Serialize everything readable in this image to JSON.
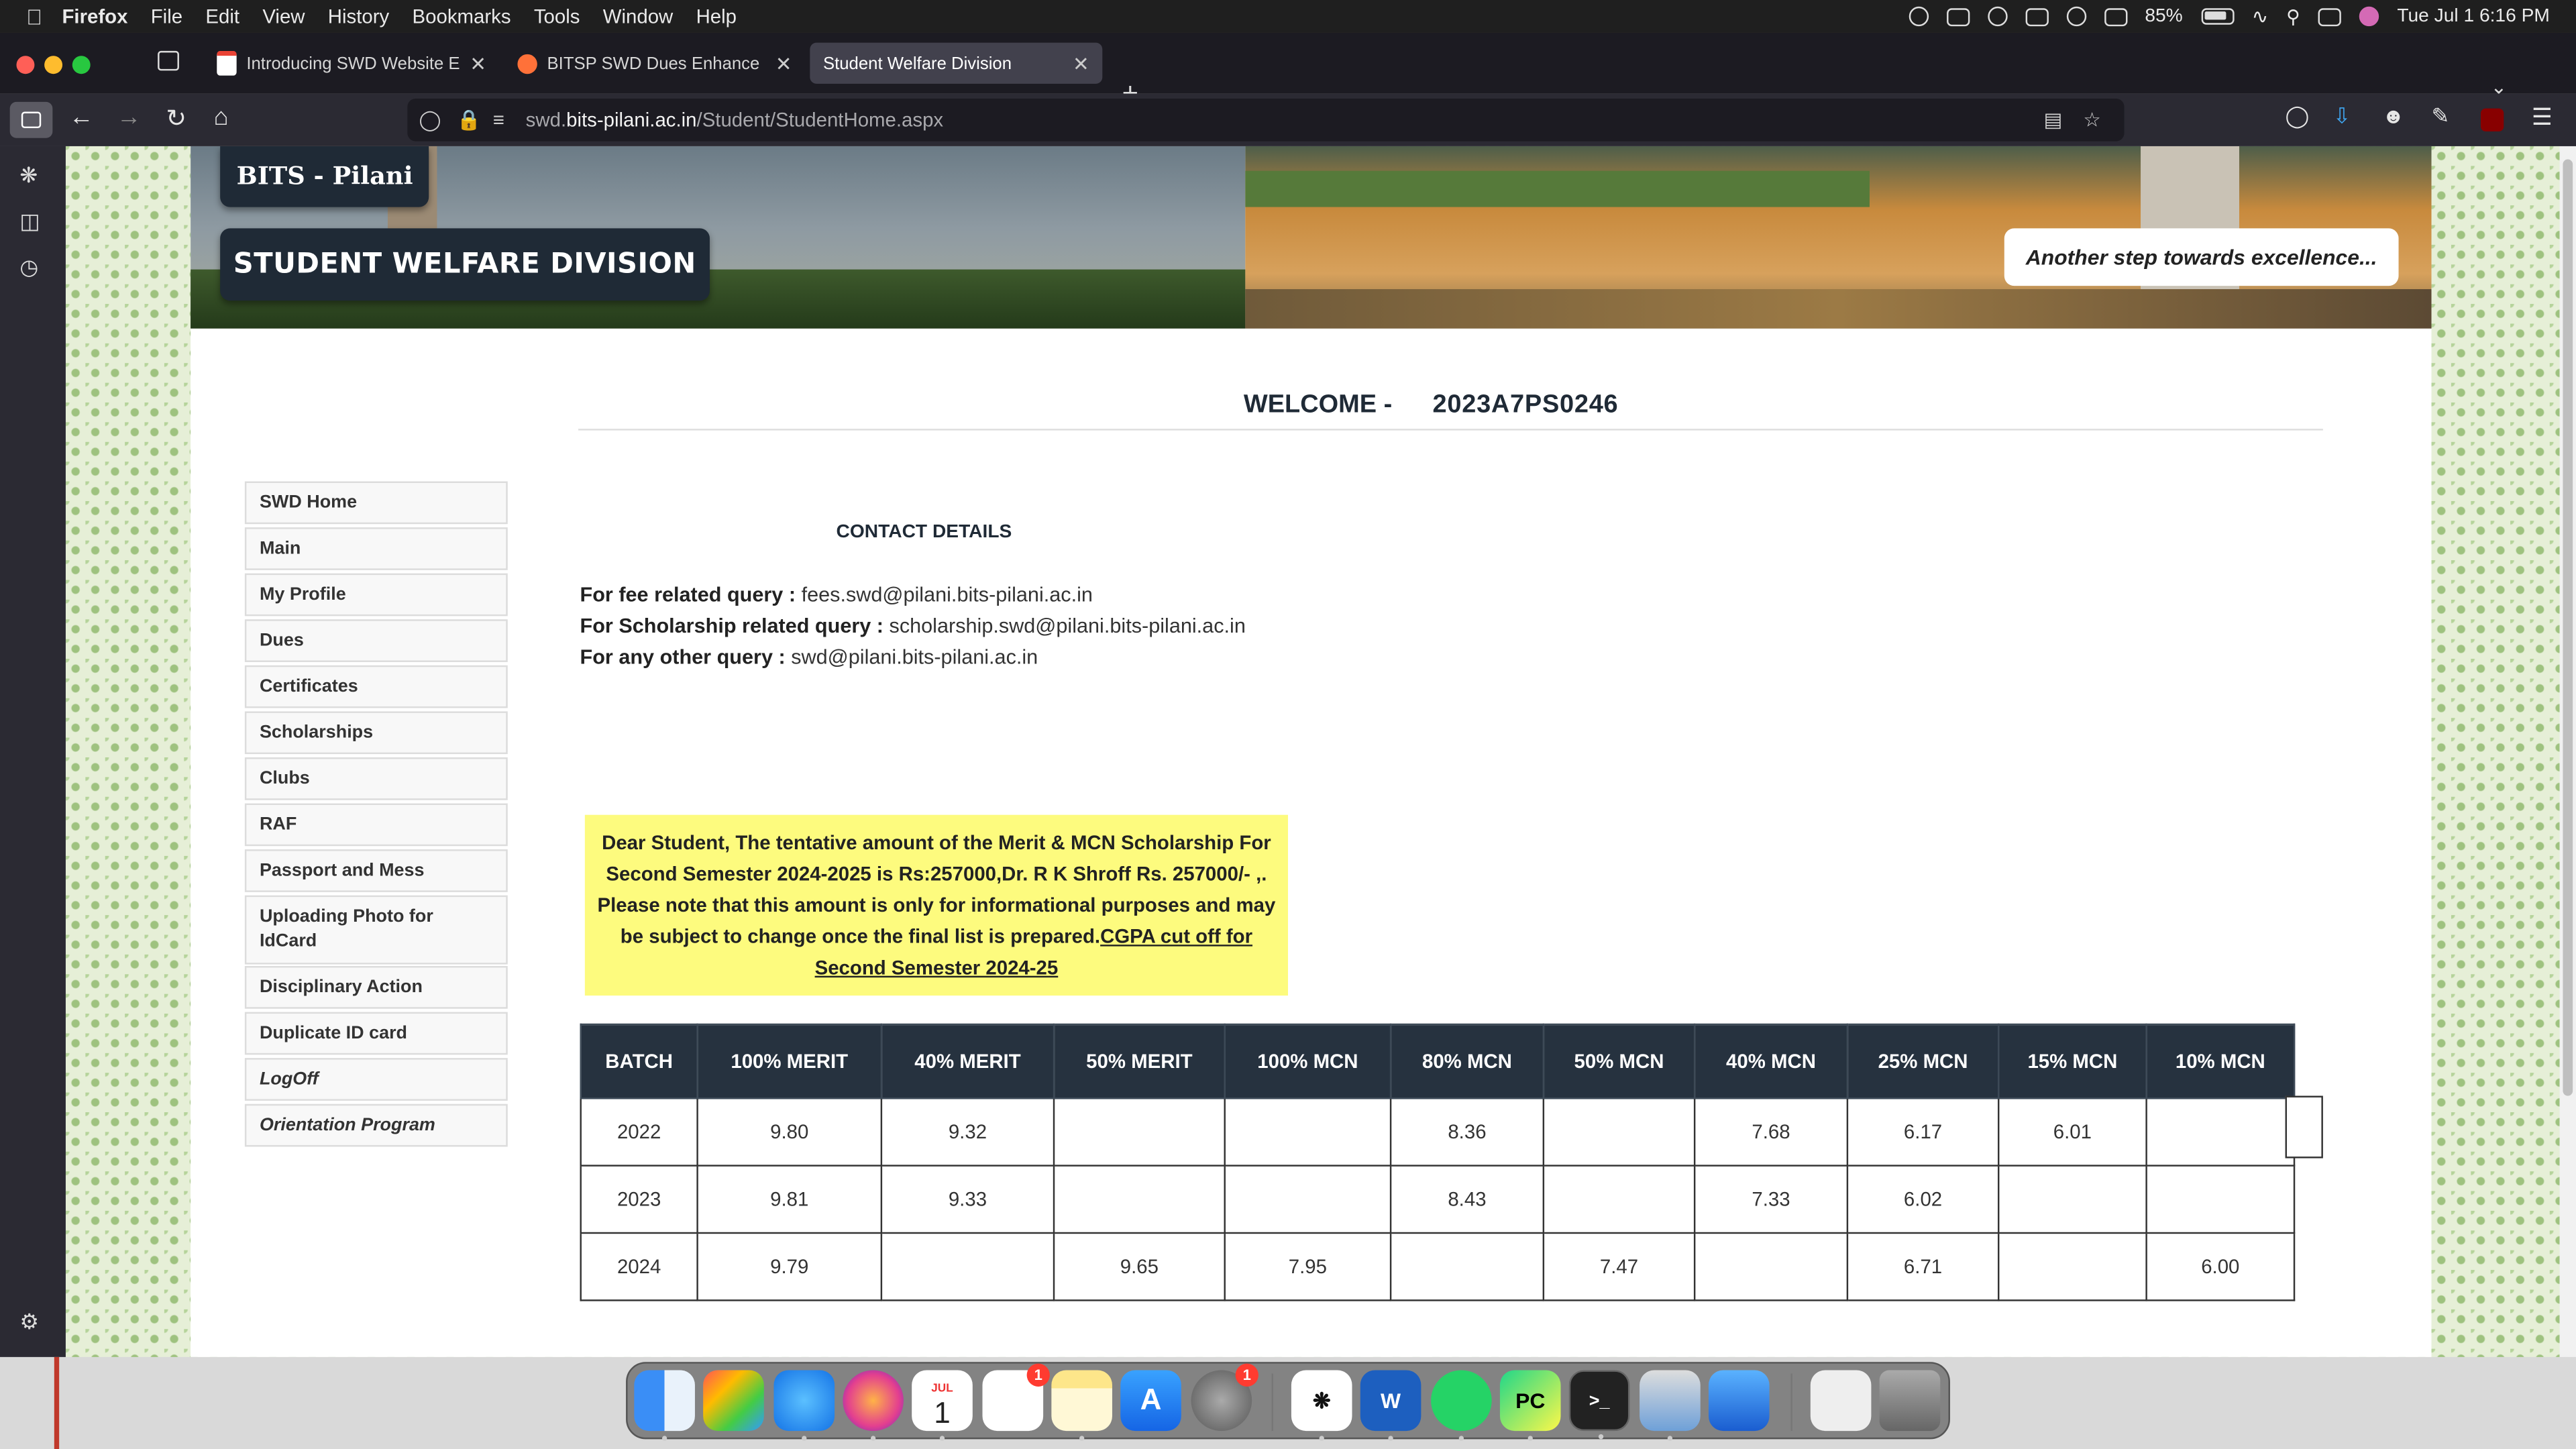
{
  "menubar": {
    "app_name": "Firefox",
    "menus": [
      "File",
      "Edit",
      "View",
      "History",
      "Bookmarks",
      "Tools",
      "Window",
      "Help"
    ],
    "battery": "85%",
    "datetime": "Tue Jul 1  6:16 PM"
  },
  "tabs": [
    {
      "title": "Introducing SWD Website Enhancer"
    },
    {
      "title": "BITSP SWD Dues Enhancer – Get"
    },
    {
      "title": "Student Welfare Division"
    }
  ],
  "address_bar": {
    "url_prefix": "swd.",
    "url_domain": "bits-pilani.ac.in",
    "url_path": "/Student/StudentHome.aspx"
  },
  "header": {
    "logo_top": "BITS - Pilani",
    "logo_main": "STUDENT WELFARE DIVISION",
    "tagline": "Another step towards excellence..."
  },
  "welcome": {
    "label": "WELCOME -",
    "student_id": "2023A7PS0246"
  },
  "nav": {
    "items": [
      {
        "label": "SWD Home"
      },
      {
        "label": "Main"
      },
      {
        "label": "My Profile"
      },
      {
        "label": "Dues"
      },
      {
        "label": "Certificates"
      },
      {
        "label": "Scholarships"
      },
      {
        "label": "Clubs"
      },
      {
        "label": "RAF"
      },
      {
        "label": "Passport and Mess"
      },
      {
        "label": "Uploading Photo for IdCard"
      },
      {
        "label": "Disciplinary Action"
      },
      {
        "label": "Duplicate ID card"
      },
      {
        "label": "LogOff"
      },
      {
        "label": "Orientation Program"
      }
    ]
  },
  "contact": {
    "title": "CONTACT DETAILS",
    "fee_label": "For fee related query :",
    "fee_email": "fees.swd@pilani.bits-pilani.ac.in",
    "scholarship_label": "For Scholarship related query :",
    "scholarship_email": "scholarship.swd@pilani.bits-pilani.ac.in",
    "other_label": "For any other query :",
    "other_email": "swd@pilani.bits-pilani.ac.in"
  },
  "notice": {
    "text": "Dear Student, The tentative amount of the Merit & MCN Scholarship For Second Semester 2024-2025 is Rs:257000,Dr. R K Shroff Rs. 257000/- ,. Please note that this amount is only for informational purposes and may be subject to change once the final list is prepared.",
    "link": "CGPA cut off for Second Semester 2024-25"
  },
  "cutoff_table": {
    "headers": [
      "BATCH",
      "100% MERIT",
      "40% MERIT",
      "50% MERIT",
      "100% MCN",
      "80% MCN",
      "50% MCN",
      "40% MCN",
      "25% MCN",
      "15% MCN",
      "10% MCN"
    ],
    "rows": [
      [
        "2022",
        "9.80",
        "9.32",
        "",
        "",
        "8.36",
        "",
        "7.68",
        "6.17",
        "6.01",
        ""
      ],
      [
        "2023",
        "9.81",
        "9.33",
        "",
        "",
        "8.43",
        "",
        "7.33",
        "6.02",
        "",
        ""
      ],
      [
        "2024",
        "9.79",
        "",
        "9.65",
        "7.95",
        "",
        "7.47",
        "",
        "6.71",
        "",
        "6.00"
      ]
    ]
  },
  "dock": {
    "calendar_month": "JUL",
    "calendar_day": "1",
    "reminders_badge": "1",
    "settings_badge": "1"
  }
}
